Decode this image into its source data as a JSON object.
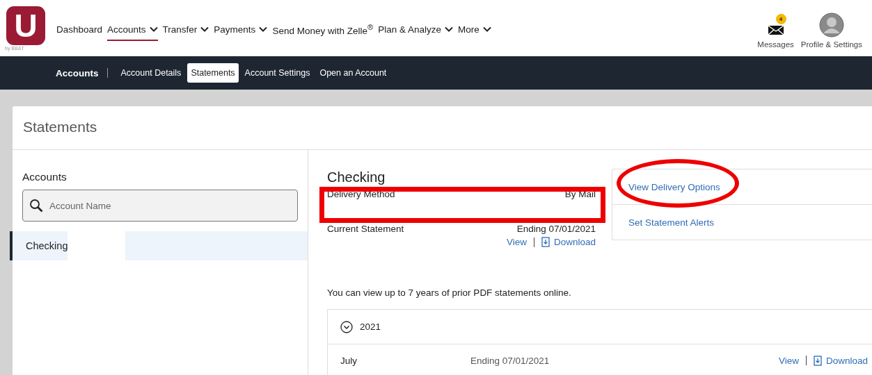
{
  "logo": {
    "letter": "U",
    "tagline": "by BB&T"
  },
  "nav": [
    {
      "label": "Dashboard",
      "dropdown": false,
      "selected": false
    },
    {
      "label": "Accounts",
      "dropdown": true,
      "selected": true
    },
    {
      "label": "Transfer",
      "dropdown": true,
      "selected": false
    },
    {
      "label": "Payments",
      "dropdown": true,
      "selected": false
    },
    {
      "label": "Send Money with Zelle$^{®}$",
      "dropdown": false,
      "selected": false
    },
    {
      "label": "Plan & Analyze",
      "dropdown": true,
      "selected": false
    },
    {
      "label": "More",
      "dropdown": true,
      "selected": false
    }
  ],
  "header_actions": {
    "messages": {
      "label": "Messages",
      "badge": "4"
    },
    "profile": {
      "label": "Profile & Settings"
    }
  },
  "subnav": {
    "title": "Accounts",
    "tabs": [
      {
        "label": "Account Details",
        "selected": false
      },
      {
        "label": "Statements",
        "selected": true
      },
      {
        "label": "Account Settings",
        "selected": false
      },
      {
        "label": "Open an Account",
        "selected": false
      }
    ]
  },
  "page_title": "Statements",
  "sidebar": {
    "heading": "Accounts",
    "search": {
      "placeholder": "Account Name"
    },
    "items": [
      {
        "label": "Checking",
        "selected": true,
        "redacted": true
      }
    ]
  },
  "account": {
    "title": "Checking",
    "details": [
      {
        "label": "Delivery Method",
        "value": "By Mail"
      },
      {
        "label": "Current Statement",
        "value": "Ending 07/01/2021",
        "links": [
          "View",
          "Download"
        ]
      }
    ],
    "options": [
      "View Delivery Options",
      "Set Statement Alerts"
    ],
    "note": "You can view up to 7 years of prior PDF statements online.",
    "years": [
      {
        "year": "2021",
        "expanded": true,
        "statements": [
          {
            "month": "July",
            "ending": "Ending 07/01/2021",
            "links": [
              "View",
              "Download"
            ]
          }
        ]
      }
    ]
  },
  "annotations": [
    {
      "kind": "rectangle"
    },
    {
      "kind": "ellipse"
    }
  ]
}
